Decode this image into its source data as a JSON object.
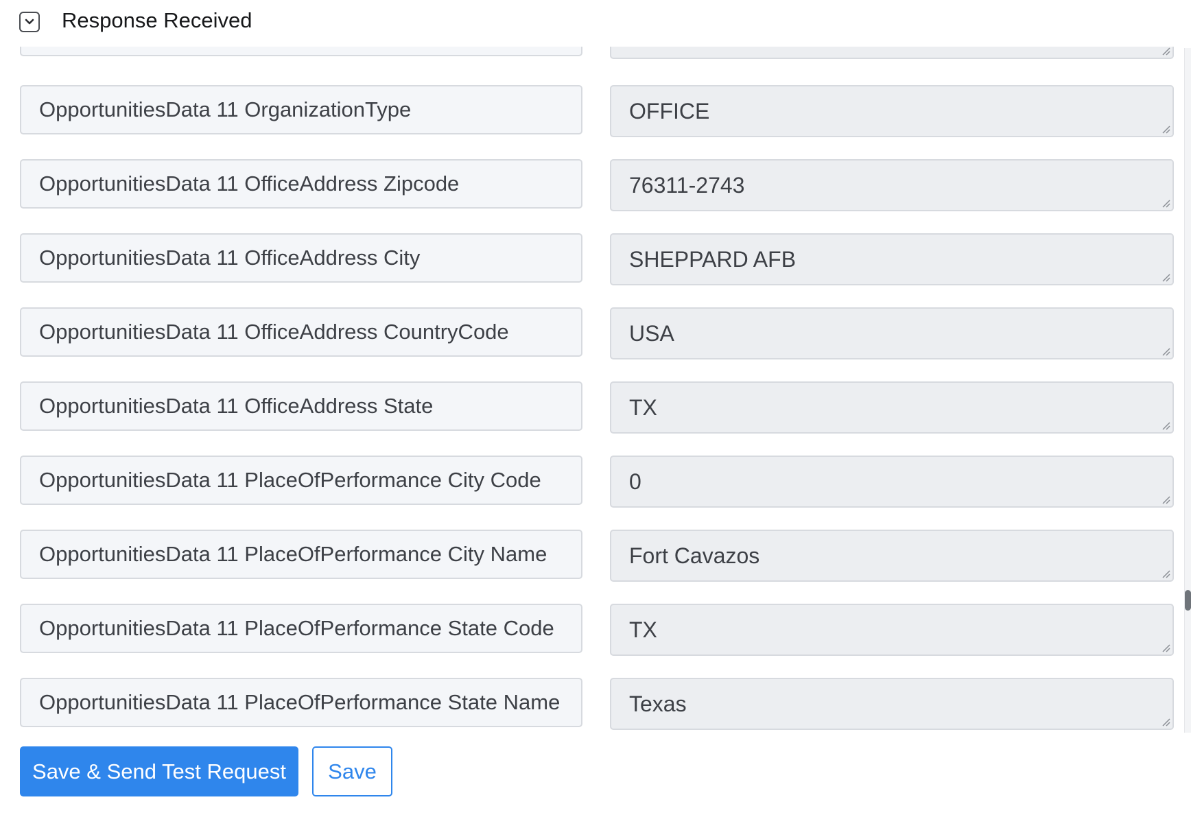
{
  "header": {
    "title": "Response Received",
    "toggle_icon": "chevron-down-icon"
  },
  "partial_row": {
    "key": "",
    "value": ""
  },
  "rows": [
    {
      "key": "OpportunitiesData 11 OrganizationType",
      "value": "OFFICE"
    },
    {
      "key": "OpportunitiesData 11 OfficeAddress Zipcode",
      "value": "76311-2743"
    },
    {
      "key": "OpportunitiesData 11 OfficeAddress City",
      "value": "SHEPPARD AFB"
    },
    {
      "key": "OpportunitiesData 11 OfficeAddress CountryCode",
      "value": "USA"
    },
    {
      "key": "OpportunitiesData 11 OfficeAddress State",
      "value": "TX"
    },
    {
      "key": "OpportunitiesData 11 PlaceOfPerformance City Code",
      "value": "0"
    },
    {
      "key": "OpportunitiesData 11 PlaceOfPerformance City Name",
      "value": "Fort Cavazos"
    },
    {
      "key": "OpportunitiesData 11 PlaceOfPerformance State Code",
      "value": "TX"
    },
    {
      "key": "OpportunitiesData 11 PlaceOfPerformance State Name",
      "value": "Texas"
    }
  ],
  "actions": {
    "save_send_label": "Save & Send Test Request",
    "save_label": "Save"
  },
  "colors": {
    "primary": "#2f86ec",
    "key_bg": "#f4f6f9",
    "value_bg": "#eceef1",
    "border": "#d7dadf"
  }
}
